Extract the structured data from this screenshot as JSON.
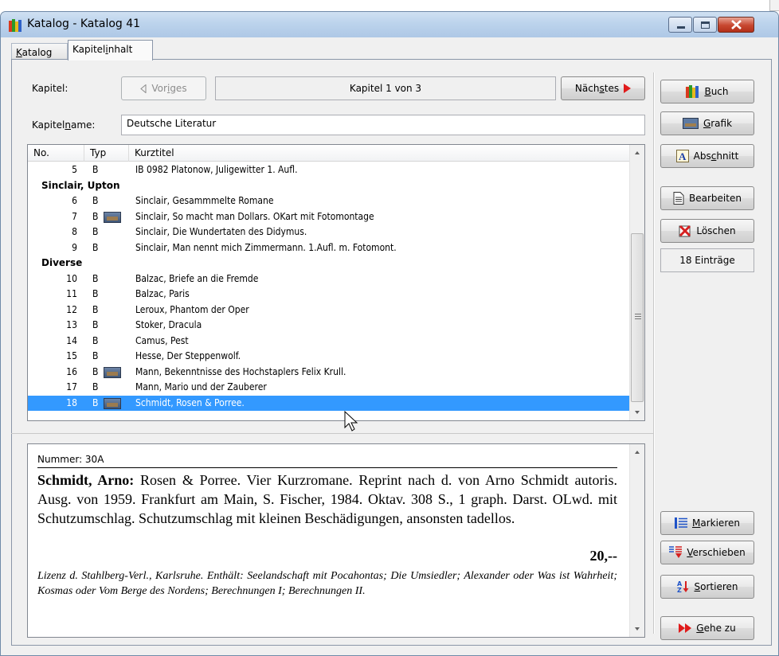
{
  "window": {
    "title": "Katalog - Katalog 41"
  },
  "tabs": [
    {
      "label_pre": "",
      "label_ul": "K",
      "label_post": "atalog"
    },
    {
      "label_pre": "Kapitel",
      "label_ul": "i",
      "label_post": "nhalt"
    }
  ],
  "chapter_nav": {
    "kapitel_label": "Kapitel:",
    "prev_pre": "Vor",
    "prev_ul": "i",
    "prev_post": "ges",
    "position_text": "Kapitel 1 von 3",
    "next_pre": "Näch",
    "next_ul": "s",
    "next_post": "tes",
    "name_label_pre": "Kapitel",
    "name_label_ul": "n",
    "name_label_post": "ame:",
    "name_value": "Deutsche Literatur"
  },
  "list": {
    "columns": [
      "No.",
      "Typ",
      "Kurztitel"
    ],
    "rows": [
      {
        "kind": "item",
        "no": "5",
        "typ": "B",
        "pic": false,
        "title": "IB 0982 Platonow, Juligewitter 1. Aufl."
      },
      {
        "kind": "group",
        "title": "Sinclair, Upton"
      },
      {
        "kind": "item",
        "no": "6",
        "typ": "B",
        "pic": false,
        "title": "Sinclair, Gesammmelte Romane"
      },
      {
        "kind": "item",
        "no": "7",
        "typ": "B",
        "pic": true,
        "title": "Sinclair, So macht man Dollars. OKart mit Fotomontage"
      },
      {
        "kind": "item",
        "no": "8",
        "typ": "B",
        "pic": false,
        "title": "Sinclair, Die Wundertaten des Didymus."
      },
      {
        "kind": "item",
        "no": "9",
        "typ": "B",
        "pic": false,
        "title": "Sinclair, Man nennt mich Zimmermann. 1.Aufl. m. Fotomont."
      },
      {
        "kind": "group",
        "title": "Diverse"
      },
      {
        "kind": "item",
        "no": "10",
        "typ": "B",
        "pic": false,
        "title": "Balzac, Briefe an die Fremde"
      },
      {
        "kind": "item",
        "no": "11",
        "typ": "B",
        "pic": false,
        "title": "Balzac, Paris"
      },
      {
        "kind": "item",
        "no": "12",
        "typ": "B",
        "pic": false,
        "title": "Leroux, Phantom der Oper"
      },
      {
        "kind": "item",
        "no": "13",
        "typ": "B",
        "pic": false,
        "title": "Stoker, Dracula"
      },
      {
        "kind": "item",
        "no": "14",
        "typ": "B",
        "pic": false,
        "title": "Camus, Pest"
      },
      {
        "kind": "item",
        "no": "15",
        "typ": "B",
        "pic": false,
        "title": "Hesse, Der Steppenwolf."
      },
      {
        "kind": "item",
        "no": "16",
        "typ": "B",
        "pic": true,
        "title": "Mann, Bekenntnisse des Hochstaplers Felix Krull."
      },
      {
        "kind": "item",
        "no": "17",
        "typ": "B",
        "pic": false,
        "title": "Mann, Mario und der Zauberer"
      },
      {
        "kind": "item",
        "no": "18",
        "typ": "B",
        "pic": true,
        "title": "Schmidt, Rosen & Porree.",
        "selected": true
      }
    ]
  },
  "detail": {
    "number_line": "Nummer: 30A",
    "author": "Schmidt, Arno:",
    "body": " Rosen & Porree. Vier Kurzromane. Reprint nach d. von Arno Schmidt autoris. Ausg. von 1959. Frankfurt am Main, S. Fischer, 1984. Oktav. 308 S., 1 graph. Darst. OLwd. mit Schutzumschlag. Schutzumschlag mit kleinen Beschädigungen, ansonsten tadellos.",
    "price": "20,--",
    "note": "Lizenz d. Stahlberg-Verl., Karlsruhe. Enthält: Seelandschaft mit Pocahontas; Die Umsiedler; Alexander oder Was ist Wahrheit; Kosmas oder Vom Berge des Nordens; Berechnungen I; Berechnungen II."
  },
  "sidebar": {
    "buch": {
      "ul": "B",
      "post": "uch"
    },
    "grafik": {
      "ul": "G",
      "post": "rafik"
    },
    "abschnitt": {
      "pre": "Abs",
      "ul": "c",
      "post": "hnitt"
    },
    "bearbeiten": {
      "label": "Bearbeiten"
    },
    "loeschen": {
      "label": "Löschen"
    },
    "count": "18 Einträge",
    "markieren": {
      "ul": "M",
      "post": "arkieren"
    },
    "verschieben": {
      "ul": "V",
      "post": "erschieben"
    },
    "sortieren": {
      "ul": "S",
      "post": "ortieren"
    },
    "gehezu": {
      "ul": "G",
      "post": "ehe zu"
    }
  },
  "icons": {
    "app": "books-icon",
    "prev": "triangle-left-icon",
    "next": "triangle-right-icon",
    "buch": "books-icon",
    "grafik": "picture-icon",
    "abschnitt": "letter-a-icon",
    "bearbeiten": "document-icon",
    "loeschen": "delete-icon",
    "markieren": "list-icon",
    "verschieben": "move-icon",
    "sortieren": "sort-az-icon",
    "gehezu": "fast-forward-icon"
  },
  "colors": {
    "selection": "#3399ff",
    "next_arrow": "#e01b1b",
    "titlebar": "#bcd3ec"
  }
}
